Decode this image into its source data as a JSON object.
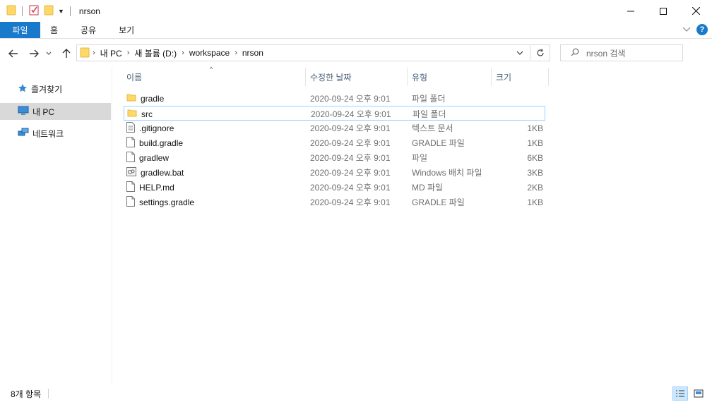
{
  "window": {
    "title": "nrson",
    "minimize_glyph": "—",
    "maximize_glyph": "☐",
    "close_glyph": "✕"
  },
  "ribbon": {
    "tabs": [
      {
        "label": "파일"
      },
      {
        "label": "홈"
      },
      {
        "label": "공유"
      },
      {
        "label": "보기"
      }
    ]
  },
  "address": {
    "crumbs": [
      "내 PC",
      "새 볼륨 (D:)",
      "workspace",
      "nrson"
    ]
  },
  "search": {
    "placeholder": "nrson 검색"
  },
  "nav": {
    "items": [
      {
        "label": "즐겨찾기",
        "icon": "star-icon"
      },
      {
        "label": "내 PC",
        "icon": "computer-icon"
      },
      {
        "label": "네트워크",
        "icon": "network-icon"
      }
    ]
  },
  "columns": {
    "name": "이름",
    "date": "수정한 날짜",
    "type": "유형",
    "size": "크기"
  },
  "files": [
    {
      "name": "gradle",
      "date": "2020-09-24 오후 9:01",
      "type": "파일 폴더",
      "size": "",
      "icon": "folder-icon"
    },
    {
      "name": "src",
      "date": "2020-09-24 오후 9:01",
      "type": "파일 폴더",
      "size": "",
      "icon": "folder-icon"
    },
    {
      "name": ".gitignore",
      "date": "2020-09-24 오후 9:01",
      "type": "텍스트 문서",
      "size": "1KB",
      "icon": "text-file-icon"
    },
    {
      "name": "build.gradle",
      "date": "2020-09-24 오후 9:01",
      "type": "GRADLE 파일",
      "size": "1KB",
      "icon": "file-icon"
    },
    {
      "name": "gradlew",
      "date": "2020-09-24 오후 9:01",
      "type": "파일",
      "size": "6KB",
      "icon": "file-icon"
    },
    {
      "name": "gradlew.bat",
      "date": "2020-09-24 오후 9:01",
      "type": "Windows 배치 파일",
      "size": "3KB",
      "icon": "batch-file-icon"
    },
    {
      "name": "HELP.md",
      "date": "2020-09-24 오후 9:01",
      "type": "MD 파일",
      "size": "2KB",
      "icon": "file-icon"
    },
    {
      "name": "settings.gradle",
      "date": "2020-09-24 오후 9:01",
      "type": "GRADLE 파일",
      "size": "1KB",
      "icon": "file-icon"
    }
  ],
  "status": {
    "count": "8개 항목"
  },
  "colors": {
    "accent": "#1979ca",
    "folder": "#ffd866",
    "selection_border": "#99d1ff"
  }
}
